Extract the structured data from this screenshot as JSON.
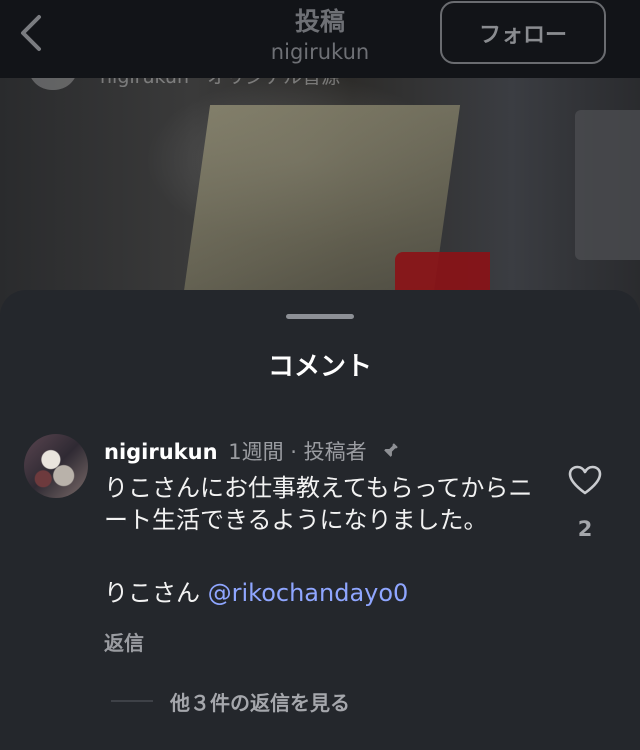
{
  "header": {
    "title": "投稿",
    "subtitle": "nigirukun",
    "follow_label": "フォロー"
  },
  "background": {
    "audio_text": "nigirukun · オリジナル音源"
  },
  "sheet": {
    "title": "コメント"
  },
  "comment": {
    "username": "nigirukun",
    "meta": "1週間 · 投稿者",
    "body": "りこさんにお仕事教えてもらってからニート生活できるようになりました。",
    "line2_prefix": "りこさん ",
    "mention": "@rikochandayo0",
    "like_count": "2",
    "reply_label": "返信",
    "more_replies_label": "他３件の返信を見る"
  },
  "icons": {
    "back": "chevron-left-icon",
    "pin": "pin-icon",
    "like": "heart-outline-icon"
  }
}
